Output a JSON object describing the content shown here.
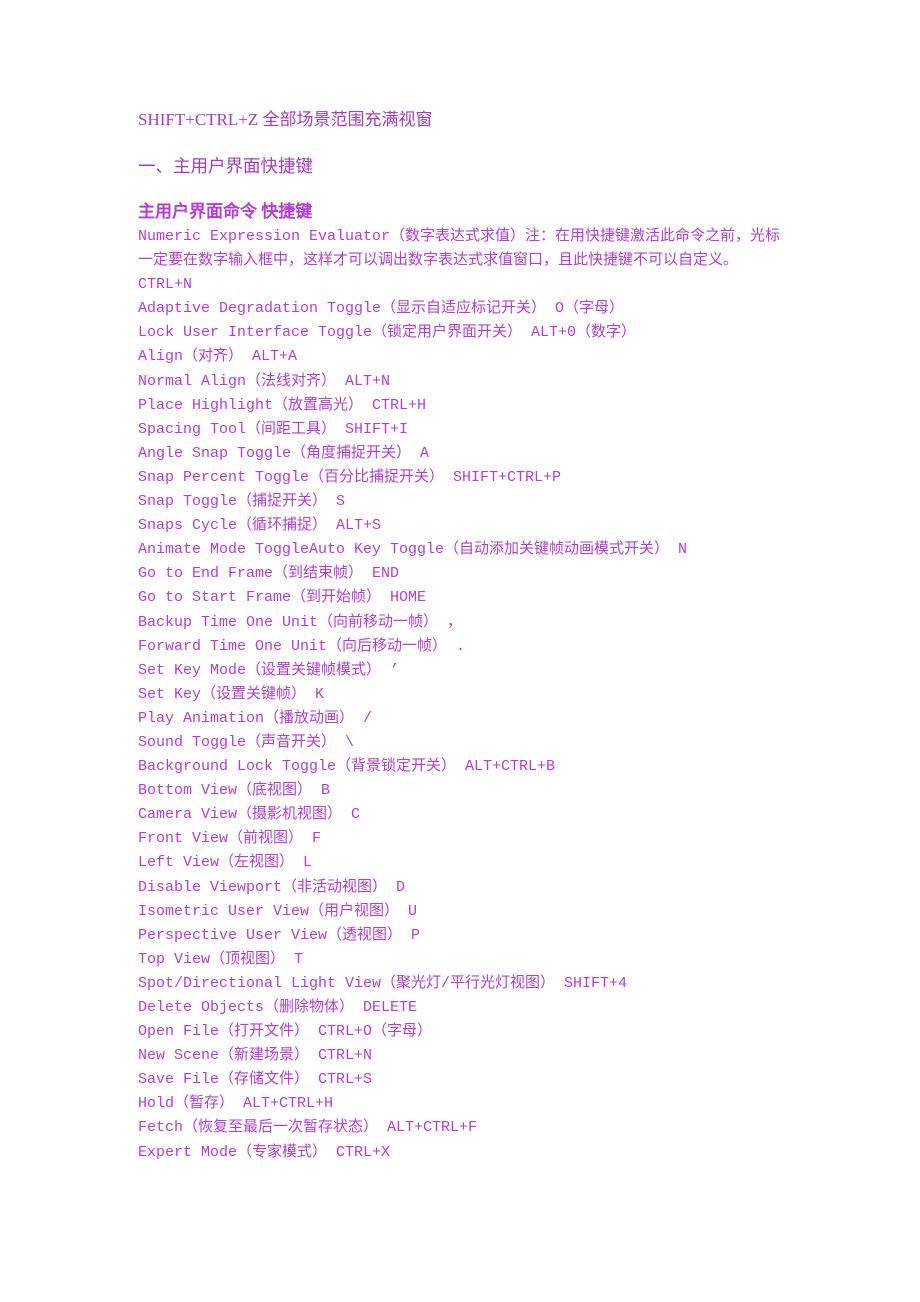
{
  "document": {
    "top_line": "SHIFT+CTRL+Z 全部场景范围充满视窗",
    "section_heading": "一、主用户界面快捷键",
    "table_heading": "主用户界面命令  快捷键",
    "text_color": "#B23FD0",
    "heading_color": "#A63CC6",
    "background_color": "#FFFFFF"
  },
  "shortcuts": [
    {
      "text": "Numeric Expression Evaluator（数字表达式求值）注：在用快捷键激活此命令之前，光标一定要在数字输入框中，这样才可以调出数字表达式求值窗口，且此快捷键不可以自定义。 CTRL+N",
      "wrap": true
    },
    {
      "text": "Adaptive Degradation Toggle（显示自适应标记开关） O（字母）",
      "wrap": false
    },
    {
      "text": "Lock User Interface Toggle（锁定用户界面开关） ALT+0（数字）",
      "wrap": false
    },
    {
      "text": "Align（对齐） ALT+A",
      "wrap": false
    },
    {
      "text": "Normal Align（法线对齐） ALT+N",
      "wrap": false
    },
    {
      "text": "Place Highlight（放置高光） CTRL+H",
      "wrap": false
    },
    {
      "text": "Spacing Tool（间距工具） SHIFT+I",
      "wrap": false
    },
    {
      "text": "Angle Snap Toggle（角度捕捉开关） A",
      "wrap": false
    },
    {
      "text": "Snap Percent Toggle（百分比捕捉开关） SHIFT+CTRL+P",
      "wrap": false
    },
    {
      "text": "Snap Toggle（捕捉开关） S",
      "wrap": false
    },
    {
      "text": "Snaps Cycle（循环捕捉） ALT+S",
      "wrap": false
    },
    {
      "text": "Animate Mode ToggleAuto Key Toggle（自动添加关键帧动画模式开关） N",
      "wrap": false
    },
    {
      "text": "Go to End Frame（到结束帧） END",
      "wrap": false
    },
    {
      "text": "Go to Start Frame（到开始帧） HOME",
      "wrap": false
    },
    {
      "text": "Backup Time One Unit（向前移动一帧） ，",
      "wrap": false
    },
    {
      "text": "Forward Time One Unit（向后移动一帧） .",
      "wrap": false
    },
    {
      "text": "Set Key Mode（设置关键帧模式） ’",
      "wrap": false
    },
    {
      "text": "Set Key（设置关键帧） K",
      "wrap": false
    },
    {
      "text": "Play Animation（播放动画） /",
      "wrap": false
    },
    {
      "text": "Sound Toggle（声音开关） \\",
      "wrap": false
    },
    {
      "text": "Background Lock Toggle（背景锁定开关） ALT+CTRL+B",
      "wrap": false
    },
    {
      "text": "Bottom View（底视图） B",
      "wrap": false
    },
    {
      "text": "Camera View（摄影机视图） C",
      "wrap": false
    },
    {
      "text": "Front View（前视图） F",
      "wrap": false
    },
    {
      "text": "Left View（左视图） L",
      "wrap": false
    },
    {
      "text": "Disable Viewport（非活动视图） D",
      "wrap": false
    },
    {
      "text": "Isometric User View（用户视图） U",
      "wrap": false
    },
    {
      "text": "Perspective User View（透视图） P",
      "wrap": false
    },
    {
      "text": "Top View（顶视图） T",
      "wrap": false
    },
    {
      "text": "Spot/Directional Light View（聚光灯/平行光灯视图） SHIFT+4",
      "wrap": false
    },
    {
      "text": "Delete Objects（删除物体） DELETE",
      "wrap": false
    },
    {
      "text": "Open File（打开文件） CTRL+O（字母）",
      "wrap": false
    },
    {
      "text": "New Scene（新建场景） CTRL+N",
      "wrap": false
    },
    {
      "text": "Save File（存储文件） CTRL+S",
      "wrap": false
    },
    {
      "text": "Hold（暂存） ALT+CTRL+H",
      "wrap": false
    },
    {
      "text": "Fetch（恢复至最后一次暂存状态） ALT+CTRL+F",
      "wrap": false
    },
    {
      "text": "Expert Mode（专家模式） CTRL+X",
      "wrap": false
    }
  ]
}
